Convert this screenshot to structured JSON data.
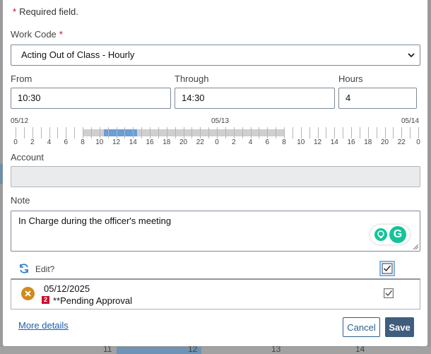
{
  "form": {
    "required_star": "*",
    "required_note": "Required field.",
    "work_code": {
      "label": "Work Code",
      "star": "*",
      "value": "Acting Out of Class - Hourly"
    },
    "from": {
      "label": "From",
      "value": "10:30"
    },
    "through": {
      "label": "Through",
      "value": "14:30"
    },
    "hours": {
      "label": "Hours",
      "value": "4"
    },
    "account": {
      "label": "Account",
      "value": ""
    },
    "note": {
      "label": "Note",
      "value": "In Charge during the officer's meeting"
    }
  },
  "timeline": {
    "dates": [
      "05/12",
      "05/13",
      "05/14"
    ],
    "hour_labels": [
      "0",
      "2",
      "4",
      "6",
      "8",
      "10",
      "12",
      "14",
      "16",
      "18",
      "20",
      "22",
      "0",
      "2",
      "4",
      "6",
      "8",
      "10",
      "12",
      "14",
      "16",
      "18",
      "20",
      "22",
      "0"
    ],
    "shift_range_hours": [
      8,
      32
    ],
    "entry_range_hours": [
      10.5,
      14.5
    ],
    "total_hours": 48
  },
  "edit": {
    "label": "Edit?",
    "checked": true
  },
  "entry": {
    "date": "05/12/2025",
    "badge": "2",
    "status": "**Pending Approval",
    "checked": true
  },
  "footer": {
    "more_details": "More details",
    "cancel": "Cancel",
    "save": "Save"
  },
  "background": {
    "days": [
      "11",
      "12",
      "13",
      "14"
    ]
  },
  "colors": {
    "accent": "#2b5f8f",
    "save_bg": "#3f5d7f",
    "required": "#d0021b",
    "timeline_entry": "#6a9fd8",
    "timeline_shift": "#cfcfcf",
    "status_icon": "#d08a1c",
    "badge": "#c8102e",
    "grammarly": "#15c39a"
  }
}
